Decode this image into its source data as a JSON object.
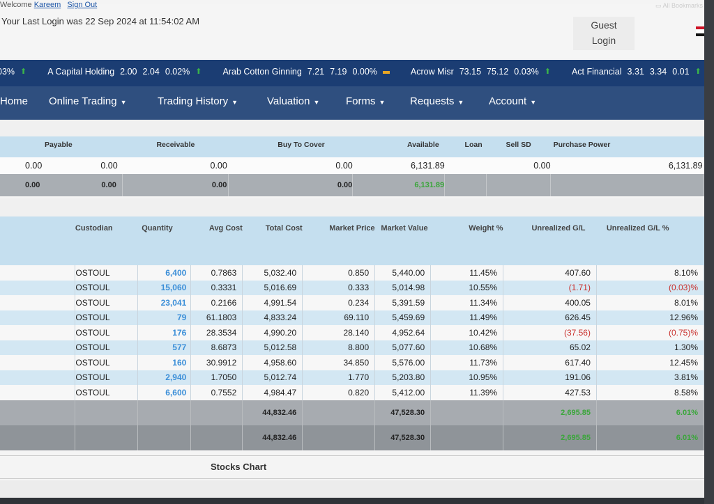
{
  "browser": {
    "bookmarks_label": "All Bookmarks"
  },
  "header": {
    "welcome_prefix": "Welcome",
    "user_name": "Kareem",
    "sign_out": "Sign Out",
    "last_login": "Your Last Login was 22 Sep 2024 at 11:54:02 AM",
    "guest_label": "Guest",
    "login_label": "Login"
  },
  "ticker": [
    {
      "name": "",
      "price": "",
      "prev": "",
      "change": "03%",
      "trend": "up"
    },
    {
      "name": "A Capital Holding",
      "price": "2.00",
      "prev": "2.04",
      "change": "0.02%",
      "trend": "up"
    },
    {
      "name": "Arab Cotton Ginning",
      "price": "7.21",
      "prev": "7.19",
      "change": "0.00%",
      "trend": "flat"
    },
    {
      "name": "Acrow Misr",
      "price": "73.15",
      "prev": "75.12",
      "change": "0.03%",
      "trend": "up"
    },
    {
      "name": "Act Financial",
      "price": "3.31",
      "prev": "3.34",
      "change": "0.01",
      "trend": "up"
    }
  ],
  "nav": {
    "home": "Home",
    "online_trading": "Online Trading",
    "trading_history": "Trading History",
    "valuation": "Valuation",
    "forms": "Forms",
    "requests": "Requests",
    "account": "Account"
  },
  "summary": {
    "headers": [
      "Payable",
      "Receivable",
      "Buy To Cover",
      "Available",
      "Loan",
      "Sell SD",
      "Purchase Power"
    ],
    "row1": [
      "0.00",
      "0.00",
      "0.00",
      "0.00",
      "6,131.89",
      "0.00",
      "6,131.89"
    ],
    "row2": [
      "0.00",
      "0.00",
      "0.00",
      "0.00",
      "6,131.89",
      "",
      ""
    ]
  },
  "holdings": {
    "headers": [
      "Custodian",
      "Quantity",
      "Avg Cost",
      "Total Cost",
      "Market Price",
      "Market Value",
      "Weight %",
      "Unrealized G/L",
      "Unrealized G/L %"
    ],
    "rows": [
      [
        "OSTOUL",
        "6,400",
        "0.7863",
        "5,032.40",
        "0.850",
        "5,440.00",
        "11.45%",
        "407.60",
        "8.10%"
      ],
      [
        "OSTOUL",
        "15,060",
        "0.3331",
        "5,016.69",
        "0.333",
        "5,014.98",
        "10.55%",
        "(1.71)",
        "(0.03)%"
      ],
      [
        "OSTOUL",
        "23,041",
        "0.2166",
        "4,991.54",
        "0.234",
        "5,391.59",
        "11.34%",
        "400.05",
        "8.01%"
      ],
      [
        "OSTOUL",
        "79",
        "61.1803",
        "4,833.24",
        "69.110",
        "5,459.69",
        "11.49%",
        "626.45",
        "12.96%"
      ],
      [
        "OSTOUL",
        "176",
        "28.3534",
        "4,990.20",
        "28.140",
        "4,952.64",
        "10.42%",
        "(37.56)",
        "(0.75)%"
      ],
      [
        "OSTOUL",
        "577",
        "8.6873",
        "5,012.58",
        "8.800",
        "5,077.60",
        "10.68%",
        "65.02",
        "1.30%"
      ],
      [
        "OSTOUL",
        "160",
        "30.9912",
        "4,958.60",
        "34.850",
        "5,576.00",
        "11.73%",
        "617.40",
        "12.45%"
      ],
      [
        "OSTOUL",
        "2,940",
        "1.7050",
        "5,012.74",
        "1.770",
        "5,203.80",
        "10.95%",
        "191.06",
        "3.81%"
      ],
      [
        "OSTOUL",
        "6,600",
        "0.7552",
        "4,984.47",
        "0.820",
        "5,412.00",
        "11.39%",
        "427.53",
        "8.58%"
      ]
    ],
    "total1": {
      "total_cost": "44,832.46",
      "market_value": "47,528.30",
      "gl": "2,695.85",
      "gl_pct": "6.01%"
    },
    "total2": {
      "total_cost": "44,832.46",
      "market_value": "47,528.30",
      "gl": "2,695.85",
      "gl_pct": "6.01%"
    }
  },
  "stocks_chart_title": "Stocks Chart",
  "colors": {
    "ticker_bg": "#1b3d73",
    "nav_bg": "#2f4f7f",
    "header_blue": "#c5dfef",
    "quantity_blue": "#3c8fd8",
    "negative_red": "#c9302c",
    "gain_green": "#3aa63a"
  }
}
